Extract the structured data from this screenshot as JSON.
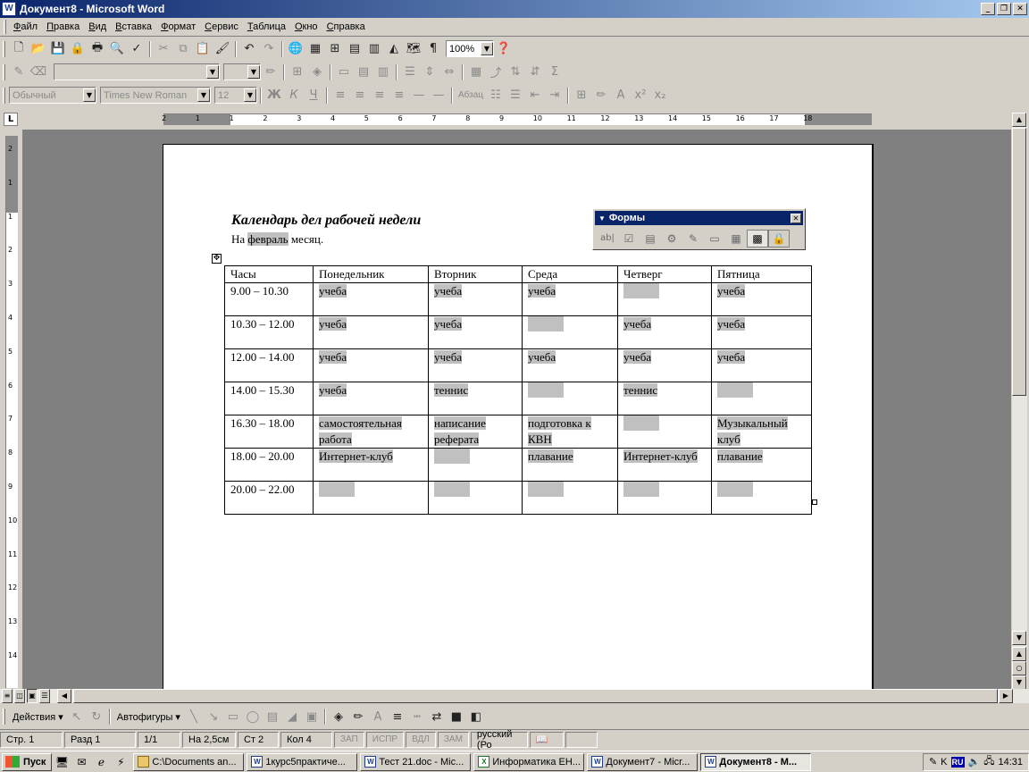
{
  "window": {
    "title": "Документ8 - Microsoft Word",
    "app_icon": "W"
  },
  "menu": [
    "Файл",
    "Правка",
    "Вид",
    "Вставка",
    "Формат",
    "Сервис",
    "Таблица",
    "Окно",
    "Справка"
  ],
  "toolbar_standard": {
    "zoom": "100%"
  },
  "toolbar_formatting": {
    "style": "Обычный",
    "font": "Times New Roman",
    "size": "12",
    "bold": "Ж",
    "italic": "К",
    "underline": "Ч",
    "paragraph": "Абзац"
  },
  "ruler": {
    "numbers": [
      "2",
      "1",
      "1",
      "2",
      "3",
      "4",
      "5",
      "6",
      "7",
      "8",
      "9",
      "10",
      "11",
      "12",
      "13",
      "14",
      "15",
      "16",
      "17",
      "18"
    ],
    "vnumbers": [
      "2",
      "1",
      "1",
      "2",
      "3",
      "4",
      "5",
      "6",
      "7",
      "8",
      "9",
      "10",
      "11",
      "12",
      "13",
      "14"
    ]
  },
  "document": {
    "title": "Календарь дел рабочей недели",
    "subtitle_pre": "На",
    "subtitle_field": "февраль",
    "subtitle_post": "месяц.",
    "table": {
      "headers": [
        "Часы",
        "Понедельник",
        "Вторник",
        "Среда",
        "Четверг",
        "Пятница"
      ],
      "rows": [
        [
          "9.00 – 10.30",
          "учеба",
          "учеба",
          "учеба",
          "",
          "учеба"
        ],
        [
          "10.30 – 12.00",
          "учеба",
          "учеба",
          "",
          "учеба",
          "учеба"
        ],
        [
          "12.00 – 14.00",
          "учеба",
          "учеба",
          "учеба",
          "учеба",
          "учеба"
        ],
        [
          "14.00 – 15.30",
          "учеба",
          "теннис",
          "",
          "теннис",
          ""
        ],
        [
          "16.30 – 18.00",
          "самостоятельная работа",
          "написание реферата",
          "подготовка к КВН",
          "",
          "Музыкальный клуб"
        ],
        [
          "18.00 – 20.00",
          "Интернет-клуб",
          "",
          "плавание",
          "Интернет-клуб",
          "плавание"
        ],
        [
          "20.00 – 22.00",
          "",
          "",
          "",
          "",
          ""
        ]
      ]
    }
  },
  "forms_toolbar": {
    "title": "Формы",
    "icons": [
      "ab-text-field-icon",
      "checkbox-icon",
      "dropdown-field-icon",
      "field-options-icon",
      "draw-table-icon",
      "insert-frame-icon",
      "insert-table-icon",
      "field-shading-icon",
      "protect-form-icon"
    ]
  },
  "drawing_toolbar": {
    "actions": "Действия",
    "autoshapes": "Автофигуры"
  },
  "status": {
    "page": "Стр. 1",
    "section": "Разд 1",
    "pages": "1/1",
    "at": "На 2,5см",
    "line": "Ст 2",
    "col": "Кол 4",
    "rec": "ЗАП",
    "trk": "ИСПР",
    "ext": "ВДЛ",
    "ovr": "ЗАМ",
    "lang": "русский (Ро"
  },
  "taskbar": {
    "start": "Пуск",
    "tasks": [
      {
        "icon": "folder",
        "label": "C:\\Documents an...",
        "active": false
      },
      {
        "icon": "W",
        "label": "1курс5практиче...",
        "active": false
      },
      {
        "icon": "W",
        "label": "Тест 21.doc - Mic...",
        "active": false
      },
      {
        "icon": "X",
        "label": "Информатика ЕН...",
        "active": false
      },
      {
        "icon": "W",
        "label": "Документ7 - Micr...",
        "active": false
      },
      {
        "icon": "W",
        "label": "Документ8 - М...",
        "active": true
      }
    ],
    "lang": "RU",
    "clock": "14:31"
  },
  "colors": {
    "titlebar": "#0a246a",
    "chrome": "#d4d0c8",
    "field_shading": "#c0c0c0",
    "workspace": "#808080"
  }
}
